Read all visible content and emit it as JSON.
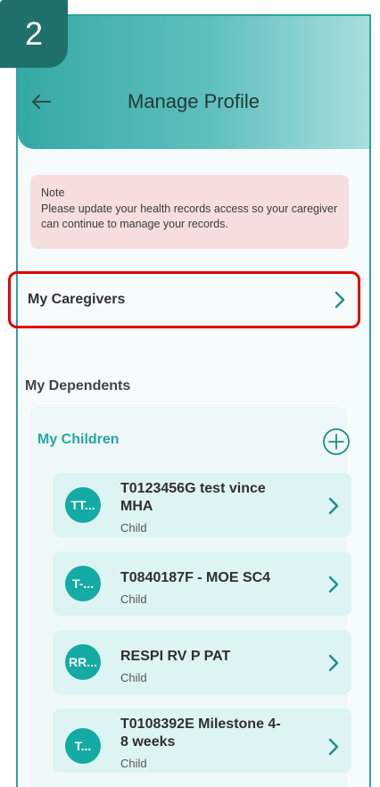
{
  "step_badge": "2",
  "header": {
    "title": "Manage Profile",
    "back_icon": "arrow-left-icon"
  },
  "note": {
    "title": "Note",
    "text": "Please update your health records access so your caregiver can continue to manage your records."
  },
  "caregivers": {
    "label": "My Caregivers",
    "icon": "chevron-right-icon"
  },
  "dependents": {
    "title": "My Dependents"
  },
  "children": {
    "title": "My Children",
    "add_icon": "plus-circle-icon",
    "items": [
      {
        "avatar": "TT...",
        "name_line1": "T0123456G test vince",
        "name_line2": "MHA",
        "role": "Child"
      },
      {
        "avatar": "T-...",
        "name_line1": "T0840187F - MOE SC4",
        "name_line2": "",
        "role": "Child"
      },
      {
        "avatar": "RR...",
        "name_line1": "RESPI RV P PAT",
        "name_line2": "",
        "role": "Child"
      },
      {
        "avatar": "T...",
        "name_line1": "T0108392E Milestone 4-",
        "name_line2": "8 weeks",
        "role": "Child"
      }
    ]
  },
  "colors": {
    "accent": "#2aa5a3",
    "highlight": "#e00000",
    "note_bg": "#f6dede",
    "avatar": "#13aba4"
  }
}
